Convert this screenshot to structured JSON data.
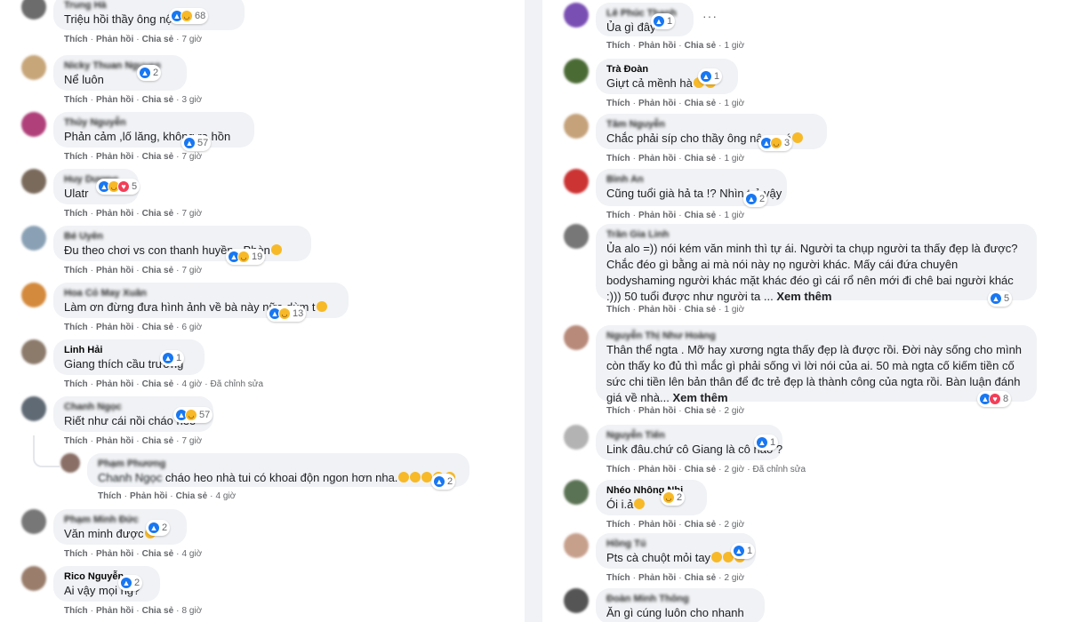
{
  "actions": {
    "like": "Thích",
    "reply": "Phản hồi",
    "share": "Chia sẻ",
    "edited": "Đã chỉnh sửa",
    "see_more": "Xem thêm"
  },
  "left": [
    {
      "name": "Trung Hà",
      "text": "Triệu hồi thầy ông nội",
      "time": "7 giờ",
      "reactions": 68,
      "react_types": [
        "like",
        "haha"
      ]
    },
    {
      "name": "Nicky Thuan Nguyen",
      "text": "Nể luôn",
      "time": "3 giờ",
      "reactions": 2,
      "react_types": [
        "like"
      ]
    },
    {
      "name": "Thủy Nguyễn",
      "text": "Phản cảm ,lố lăng, không ra hồn",
      "time": "7 giờ",
      "reactions": 57,
      "react_types": [
        "like"
      ]
    },
    {
      "name": "Huy Dương",
      "text": "Ulatr",
      "time": "7 giờ",
      "reactions": 5,
      "react_types": [
        "like",
        "haha",
        "love"
      ]
    },
    {
      "name": "Bé Uyên",
      "text": "Đu theo chơi vs con thanh huyền , Phèn",
      "time": "7 giờ",
      "reactions": 19,
      "react_types": [
        "like",
        "haha"
      ]
    },
    {
      "name": "Hoa Cỏ May Xuân",
      "text": "Làm ơn đừng đưa hình ảnh về bà này nữa dùm t",
      "time": "6 giờ",
      "reactions": 13,
      "react_types": [
        "like",
        "haha"
      ]
    },
    {
      "name": "Linh Hải",
      "text": "Giang thích cầu trường",
      "time": "4 giờ",
      "reactions": 1,
      "react_types": [
        "like"
      ],
      "edited": true
    },
    {
      "name": "Chanh Ngọc",
      "text": "Riết như cái nồi cháo heo",
      "time": "7 giờ",
      "reactions": 57,
      "react_types": [
        "like",
        "haha"
      ]
    },
    {
      "name": "Phạm Phương",
      "mention": "Chanh Ngọc",
      "text": "cháo heo nhà tui có khoai độn ngon hơn nha.",
      "time": "4 giờ",
      "reactions": 2,
      "react_types": [
        "like"
      ],
      "reply": true
    },
    {
      "name": "Phạm Minh Đức",
      "text": "Văn minh được",
      "time": "4 giờ",
      "reactions": 2,
      "react_types": [
        "like"
      ]
    },
    {
      "name": "Rico Nguyễn",
      "text": "Ai vậy mọi ng?",
      "time": "8 giờ",
      "reactions": 2,
      "react_types": [
        "like"
      ]
    }
  ],
  "right": [
    {
      "name": "Lê Phúc Thanh",
      "text": "Ủa gì đây",
      "time": "1 giờ",
      "reactions": 1,
      "react_types": [
        "like"
      ]
    },
    {
      "name": "Trà Đoàn",
      "text": "Giựt cả mềnh hà",
      "time": "1 giờ",
      "reactions": 1,
      "react_types": [
        "like"
      ]
    },
    {
      "name": "Tâm Nguyễn",
      "text": "Chắc phải síp cho thầy ông nậu quá",
      "time": "1 giờ",
      "reactions": 3,
      "react_types": [
        "like",
        "haha"
      ]
    },
    {
      "name": "Bình An",
      "text": "Cũng tuổi già hả ta !? Nhìn trẻ vậy",
      "time": "1 giờ",
      "reactions": 2,
      "react_types": [
        "like"
      ]
    },
    {
      "name": "Trần Gia Linh",
      "text": "Ủa alo =)) nói kém văn minh thì tự ái. Người ta chụp người ta thấy đẹp là được? Chắc đéo gì bằng ai mà nói này nọ người khác. Mấy cái đứa chuyên bodyshaming người khác mặt khác đéo gì cái rổ nên mới đi chê bai người khác :))) 50 tuổi được như người ta ...",
      "time": "1 giờ",
      "reactions": 5,
      "react_types": [
        "like"
      ],
      "see_more": true
    },
    {
      "name": "Nguyễn Thị Như Hoàng",
      "text": "Thân thể ngta . Mỡ hay xương ngta thấy đẹp là được rồi. Đời này sống cho mình còn thấy ko đủ thì mắc gì phải sống vì lời nói của ai. 50 mà ngta cố kiếm tiền cố sức chi tiền lên bản thân để đc trẻ đẹp là thành công của ngta rồi. Bàn luận đánh giá về nhà...",
      "time": "2 giờ",
      "reactions": 8,
      "react_types": [
        "like",
        "love"
      ],
      "see_more": true
    },
    {
      "name": "Nguyễn Tiến",
      "text": "Link đâu.chứ cô Giang là cô nào ?",
      "time": "2 giờ",
      "reactions": 1,
      "react_types": [
        "like"
      ],
      "edited": true
    },
    {
      "name": "Nhéo Nhông Nhi",
      "text": "Ói i.ả",
      "time": "2 giờ",
      "reactions": 2,
      "react_types": [
        "haha"
      ]
    },
    {
      "name": "Hồng Tú",
      "text": "Pts cà chuột mỏi tay",
      "time": "2 giờ",
      "reactions": 1,
      "react_types": [
        "like"
      ]
    },
    {
      "name": "Đoàn Minh Thông",
      "text": "Ăn gì cúng luôn cho nhanh",
      "time": "",
      "reactions": null,
      "react_types": []
    }
  ],
  "colors": {
    "bubble": "#f0f2f5",
    "like": "#1877f2",
    "haha": "#f7b928",
    "love": "#f33e58",
    "meta": "#65676b"
  }
}
